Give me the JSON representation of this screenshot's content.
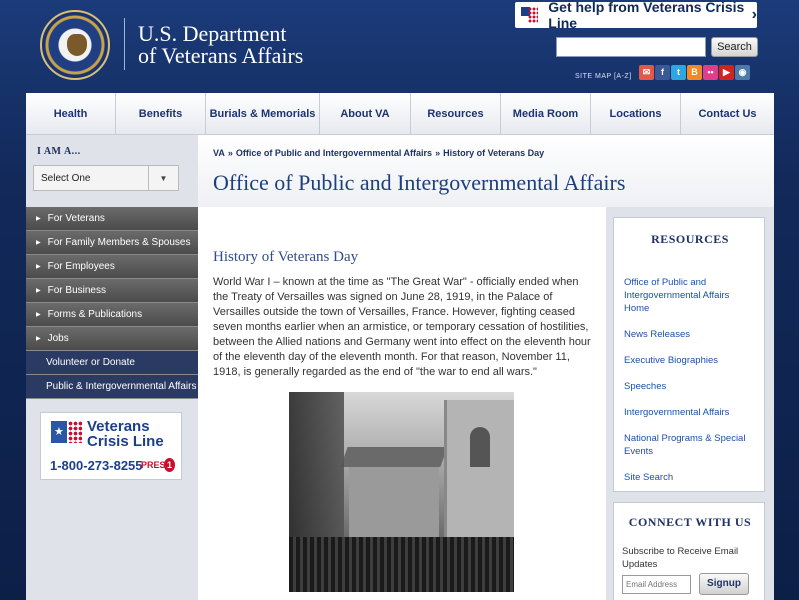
{
  "header": {
    "dept_line1": "U.S. Department",
    "dept_line2": "of Veterans Affairs",
    "crisis_banner": "Get help from Veterans Crisis Line",
    "search_placeholder": "",
    "search_button": "Search",
    "sitemap": "SITE MAP [A-Z]",
    "social": [
      {
        "icon": "email-icon",
        "glyph": "✉",
        "color": "#e05a47"
      },
      {
        "icon": "facebook-icon",
        "glyph": "f",
        "color": "#3b5998"
      },
      {
        "icon": "twitter-icon",
        "glyph": "t",
        "color": "#2fa6e0"
      },
      {
        "icon": "blogger-icon",
        "glyph": "B",
        "color": "#f08a22"
      },
      {
        "icon": "flickr-icon",
        "glyph": "••",
        "color": "#e03d8a"
      },
      {
        "icon": "youtube-icon",
        "glyph": "▶",
        "color": "#d42222"
      },
      {
        "icon": "instagram-icon",
        "glyph": "◉",
        "color": "#4d7aa8"
      }
    ]
  },
  "nav": [
    {
      "label": "Health",
      "width": 90
    },
    {
      "label": "Benefits",
      "width": 90
    },
    {
      "label": "Burials & Memorials",
      "width": 114
    },
    {
      "label": "About VA",
      "width": 91
    },
    {
      "label": "Resources",
      "width": 90
    },
    {
      "label": "Media Room",
      "width": 90
    },
    {
      "label": "Locations",
      "width": 90
    },
    {
      "label": "Contact Us",
      "width": 93
    }
  ],
  "sidebar": {
    "iam_label": "I AM A...",
    "select_value": "Select One",
    "items": [
      {
        "label": "For Veterans",
        "arrow": true
      },
      {
        "label": "For Family Members & Spouses",
        "arrow": true
      },
      {
        "label": "For Employees",
        "arrow": true
      },
      {
        "label": "For Business",
        "arrow": true
      },
      {
        "label": "Forms & Publications",
        "arrow": true
      },
      {
        "label": "Jobs",
        "arrow": true
      },
      {
        "label": "Volunteer or Donate",
        "arrow": false
      },
      {
        "label": "Public & Intergovernmental Affairs",
        "arrow": false
      }
    ],
    "crisis_card": {
      "name1": "Veterans",
      "name2": "Crisis Line",
      "phone": "1-800-273-8255",
      "press": "PRESS",
      "press_number": "1"
    }
  },
  "breadcrumb": [
    "VA",
    "»",
    "Office of Public and Intergovernmental Affairs",
    "»",
    "History of Veterans Day"
  ],
  "page_title": "Office of Public and Intergovernmental Affairs",
  "article": {
    "title": "History of Veterans Day",
    "body": "World War I – known at the time as \"The Great War\" - officially ended when the Treaty of Versailles was signed on June 28, 1919, in the Palace of Versailles outside the town of Versailles, France. However, fighting ceased seven months earlier when an armistice, or temporary cessation of hostilities, between the Allied nations and Germany went into effect on the eleventh hour of the eleventh day of the eleventh month. For that reason, November 11, 1918, is generally regarded as the end of \"the war to end all wars.\""
  },
  "resources": {
    "title": "RESOURCES",
    "links": [
      "Office of Public and Intergovernmental Affairs Home",
      "News Releases",
      "Executive Biographies",
      "Speeches",
      "Intergovernmental Affairs",
      "National Programs & Special Events",
      "Site Search"
    ]
  },
  "connect": {
    "title": "CONNECT WITH US",
    "subscribe_text": "Subscribe to Receive Email Updates",
    "email_placeholder": "Email Address",
    "signup_label": "Signup"
  }
}
